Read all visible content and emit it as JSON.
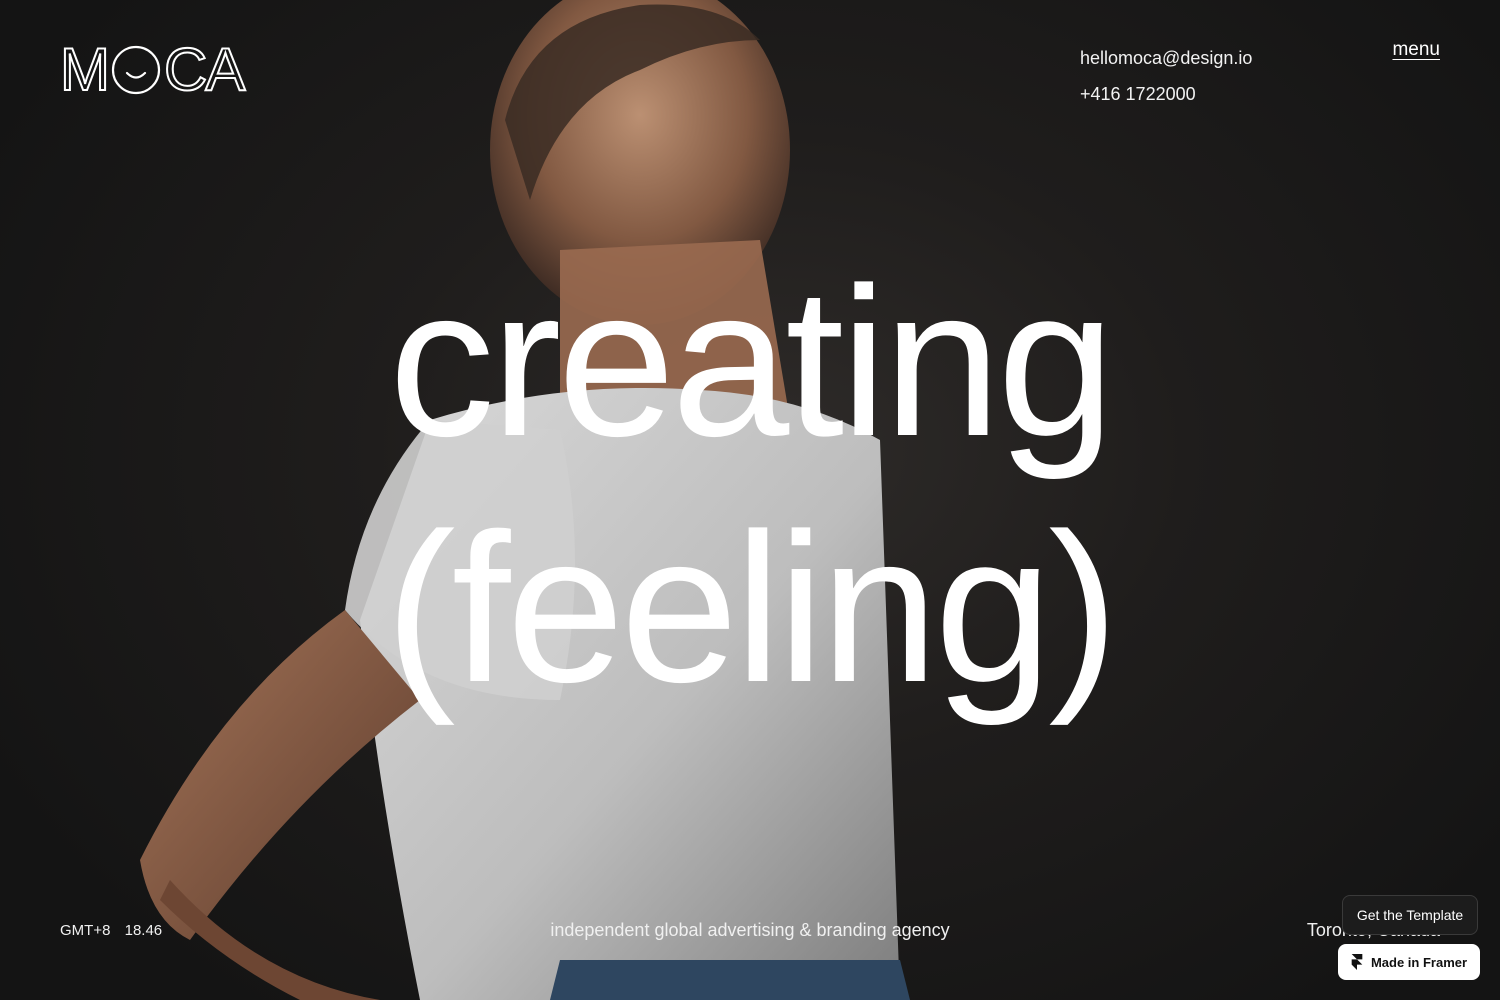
{
  "brand": {
    "logo_letters": [
      "M",
      "C",
      "A"
    ],
    "logo_icon": "smiley-o-icon"
  },
  "header": {
    "email": "hellomoca@design.io",
    "phone": "+416 1722000",
    "menu_label": "menu"
  },
  "hero": {
    "line1": "creating",
    "line2": "(feeling)",
    "image": "portrait-photo"
  },
  "footer": {
    "timezone": "GMT+8",
    "time": "18.46",
    "tagline": "independent global advertising & branding agency",
    "location": "Toronto, Canada"
  },
  "overlay": {
    "get_template_label": "Get the Template",
    "made_in_framer_label": "Made in Framer",
    "framer_icon": "framer-icon"
  },
  "colors": {
    "background": "#1a1a1a",
    "text": "#ffffff",
    "framer_badge_bg": "#ffffff"
  }
}
